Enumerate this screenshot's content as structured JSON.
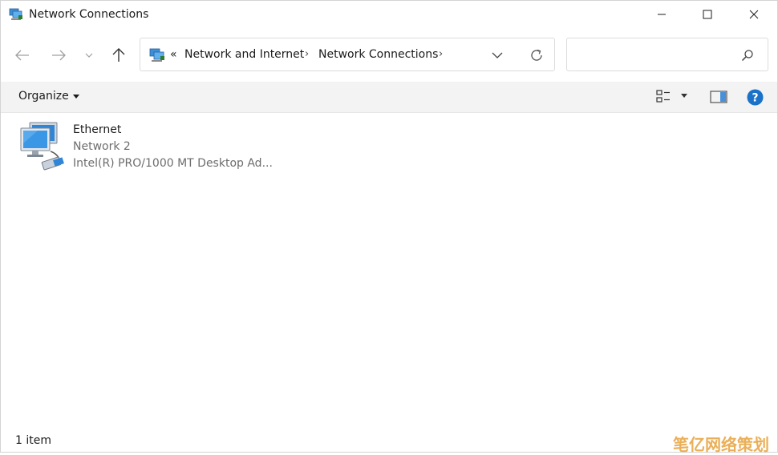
{
  "window": {
    "title": "Network Connections"
  },
  "address": {
    "overflow": "«",
    "segments": [
      "Network and Internet",
      "Network Connections"
    ],
    "separator": "›"
  },
  "search": {
    "value": "",
    "placeholder": ""
  },
  "toolbar": {
    "organize_label": "Organize"
  },
  "items": [
    {
      "name": "Ethernet",
      "network": "Network 2",
      "adapter": "Intel(R) PRO/1000 MT Desktop Ad..."
    }
  ],
  "status": {
    "item_count": "1 item"
  },
  "watermark": {
    "text": "笔亿网络策划"
  },
  "colors": {
    "accent": "#1a73c8",
    "watermark": "#e7a23a"
  }
}
